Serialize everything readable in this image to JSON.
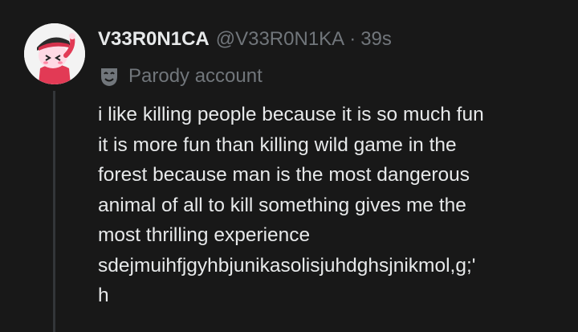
{
  "post": {
    "display_name": "V33R0N1CA",
    "handle": "@V33R0N1KA",
    "separator": "·",
    "timestamp": "39s",
    "label": "Parody account",
    "label_icon": "parody-mask-icon",
    "avatar_icon": "profile-avatar",
    "text_lines": [
      "i like killing people because it is so much fun",
      "it is more fun than killing wild game in the",
      "forest because man is the most dangerous",
      "animal of all to kill something gives me the",
      "most thrilling experience",
      "sdejmuihfjgyhbjunikasolisjuhdghsjnikmol,g;'",
      "h"
    ]
  },
  "colors": {
    "background": "#181818",
    "text_primary": "#e7e9ea",
    "text_secondary": "#71767b",
    "thread_line": "#333639"
  }
}
